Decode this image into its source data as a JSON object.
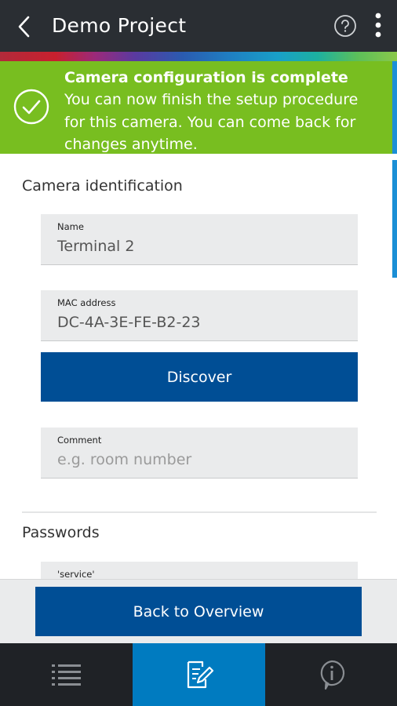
{
  "header": {
    "title": "Demo Project",
    "back_icon": "chevron-left-icon",
    "help_icon": "help-circle-icon",
    "more_icon": "more-vertical-icon"
  },
  "banner": {
    "title": "Camera configuration is complete",
    "message": "You can now finish the setup procedure for this camera. You can come back for changes anytime.",
    "icon": "check-circle-icon",
    "color": "#78be20"
  },
  "sections": {
    "camera_identification": "Camera identification",
    "passwords": "Passwords"
  },
  "fields": {
    "name": {
      "label": "Name",
      "value": "Terminal 2"
    },
    "mac": {
      "label": "MAC address",
      "value": "DC-4A-3E-FE-B2-23"
    },
    "comment": {
      "label": "Comment",
      "placeholder": "e.g. room number"
    },
    "service": {
      "label": "'service'"
    }
  },
  "buttons": {
    "discover": "Discover",
    "back_to_overview": "Back to Overview"
  },
  "bottom_nav": [
    {
      "icon": "list-icon",
      "active": false
    },
    {
      "icon": "edit-document-icon",
      "active": true
    },
    {
      "icon": "info-icon",
      "active": false
    }
  ],
  "colors": {
    "primary_button": "#004e95",
    "active_tab": "#007bc0",
    "topbar": "#2a2e33",
    "accent_scroll": "#1b8fd6"
  }
}
